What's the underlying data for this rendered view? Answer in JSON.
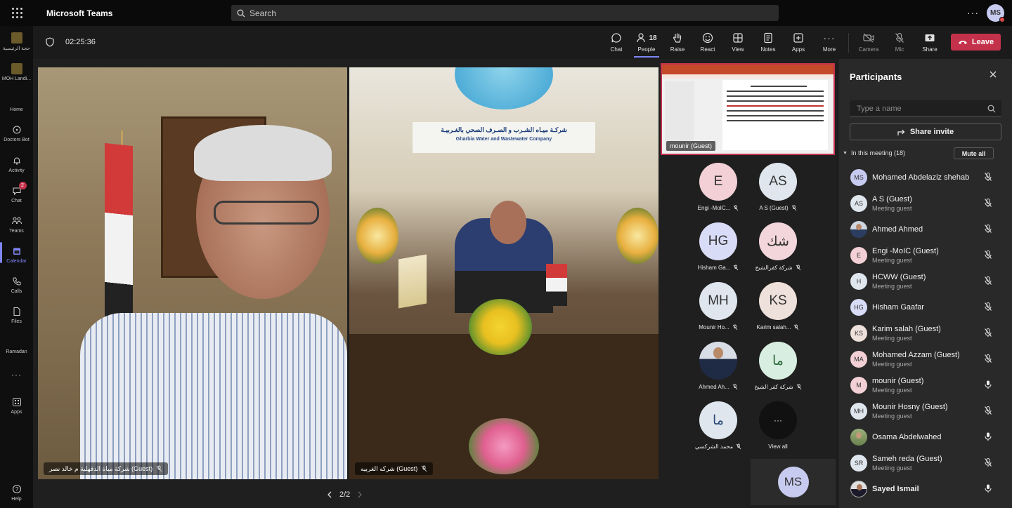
{
  "app": {
    "title": "Microsoft Teams",
    "user_initials": "MS"
  },
  "search": {
    "placeholder": "Search"
  },
  "rail": [
    {
      "label": "حجة الرئيسية",
      "icon": "app-tile-icon"
    },
    {
      "label": "MOH Landi...",
      "icon": "app-tile-icon"
    },
    {
      "label": "Home",
      "icon": "home-icon"
    },
    {
      "label": "Doctors Bot",
      "icon": "bot-icon"
    },
    {
      "label": "Activity",
      "icon": "bell-icon"
    },
    {
      "label": "Chat",
      "icon": "chat-icon",
      "badge": "2"
    },
    {
      "label": "Teams",
      "icon": "teams-icon"
    },
    {
      "label": "Calendar",
      "icon": "calendar-icon"
    },
    {
      "label": "Calls",
      "icon": "phone-icon"
    },
    {
      "label": "Files",
      "icon": "file-icon"
    },
    {
      "label": "Ramadan",
      "icon": "pin-icon"
    },
    {
      "label": "Apps",
      "icon": "apps-icon"
    },
    {
      "label": "Help",
      "icon": "help-icon"
    }
  ],
  "meeting": {
    "timer": "02:25:36",
    "people_count": "18",
    "toolbar": {
      "chat": "Chat",
      "people": "People",
      "raise": "Raise",
      "react": "React",
      "view": "View",
      "notes": "Notes",
      "apps": "Apps",
      "more": "More",
      "camera": "Camera",
      "mic": "Mic",
      "share": "Share",
      "leave": "Leave"
    }
  },
  "videos": [
    {
      "label": "شركة مياة الدقهلية م خالد نصر (Guest)"
    },
    {
      "label": "شركه الغربيه (Guest)"
    }
  ],
  "video2_banner": {
    "arabic": "شركـة ميـاه الشـرب و الصـرف الصحي بالغـربيـة",
    "english": "Gharbia Water and Wastewater Company"
  },
  "share_thumb": {
    "label": "mounir (Guest)"
  },
  "tiles": [
    {
      "initials": "E",
      "name": "Engi -MoIC...",
      "bg": "#f2d0d6"
    },
    {
      "initials": "AS",
      "name": "A S (Guest)",
      "bg": "#dfe6ee"
    },
    {
      "initials": "HG",
      "name": "Hisham Ga...",
      "bg": "#d9dcf6"
    },
    {
      "initials": "شك",
      "name": "شركة كفرالشيخ",
      "bg": "#f2d6dc"
    },
    {
      "initials": "MH",
      "name": "Mounir Ho...",
      "bg": "#dfe6ee"
    },
    {
      "initials": "KS",
      "name": "Karim salah...",
      "bg": "#eee0da"
    },
    {
      "initials": "",
      "name": "Ahmed Ah...",
      "bg": "#d8dde6"
    },
    {
      "initials": "ما",
      "name": "شركة كفر الشيخ",
      "bg": "#d8eee0"
    },
    {
      "initials": "ما",
      "name": "محمد الشركسي",
      "bg": "#dfe6ee"
    },
    {
      "initials": "···",
      "name": "View all",
      "bg": "#111111"
    }
  ],
  "self_tile": {
    "initials": "MS"
  },
  "pager": {
    "text": "2/2"
  },
  "panel": {
    "title": "Participants",
    "search_placeholder": "Type a name",
    "invite": "Share invite",
    "in_meeting": "In this meeting (18)",
    "mute_all": "Mute all",
    "participants": [
      {
        "initials": "MS",
        "name": "Mohamed Abdelaziz shehab",
        "role": "",
        "bg": "#c8cbf0",
        "mic": "muted"
      },
      {
        "initials": "AS",
        "name": "A S (Guest)",
        "role": "Meeting guest",
        "bg": "#dfe6ee",
        "mic": "muted"
      },
      {
        "initials": "",
        "name": "Ahmed Ahmed",
        "role": "",
        "bg": "photo",
        "mic": "muted"
      },
      {
        "initials": "E",
        "name": "Engi -MoIC (Guest)",
        "role": "Meeting guest",
        "bg": "#f2d0d6",
        "mic": "muted"
      },
      {
        "initials": "H",
        "name": "HCWW (Guest)",
        "role": "Meeting guest",
        "bg": "#dfe6ee",
        "mic": "muted"
      },
      {
        "initials": "HG",
        "name": "Hisham Gaafar",
        "role": "",
        "bg": "#d9dcf6",
        "mic": "muted"
      },
      {
        "initials": "KS",
        "name": "Karim salah (Guest)",
        "role": "Meeting guest",
        "bg": "#eee0da",
        "mic": "muted"
      },
      {
        "initials": "MA",
        "name": "Mohamed Azzam (Guest)",
        "role": "Meeting guest",
        "bg": "#f2d0d6",
        "mic": "muted"
      },
      {
        "initials": "M",
        "name": "mounir (Guest)",
        "role": "Meeting guest",
        "bg": "#f2d0d6",
        "mic": "on"
      },
      {
        "initials": "MH",
        "name": "Mounir Hosny (Guest)",
        "role": "Meeting guest",
        "bg": "#dfe6ee",
        "mic": "muted"
      },
      {
        "initials": "",
        "name": "Osama Abdelwahed",
        "role": "",
        "bg": "photo-green",
        "mic": "on"
      },
      {
        "initials": "SR",
        "name": "Sameh reda (Guest)",
        "role": "Meeting guest",
        "bg": "#dfe6ee",
        "mic": "muted"
      },
      {
        "initials": "",
        "name": "Sayed Ismail",
        "role": "",
        "bg": "photo-dark",
        "mic": "on",
        "bold": true
      }
    ]
  }
}
